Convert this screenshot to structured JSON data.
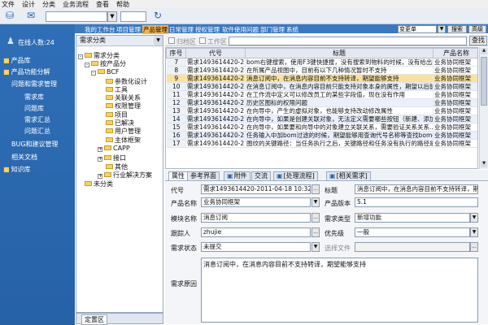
{
  "menu": {
    "items": [
      "文件",
      "设计",
      "分类",
      "业务流程",
      "查看",
      "帮助"
    ]
  },
  "toolbar": {
    "combo_value": "",
    "combo_arrow": "▼"
  },
  "leftnav": {
    "online": "在线人数:24",
    "items": [
      "产品库",
      "产品功能分解",
      "问题和需求管理",
      "需求库",
      "问题库",
      "需求汇总",
      "问题汇总",
      "BUG和建议管理",
      "相关文档",
      "知识库"
    ]
  },
  "topnav": {
    "items": [
      "我的工作台",
      "项目管理",
      "产品管理",
      "日常管理",
      "授权管理",
      "软件使用问题",
      "部门管理",
      "系统"
    ],
    "version_select": "变更单",
    "search_label": "搜索",
    "advanced_label": "高级"
  },
  "tree": {
    "title": "需求分类",
    "nodes": [
      "需求分类",
      "按产品分",
      "BCF",
      "参数化设计",
      "工具",
      "关联关系",
      "权限管理",
      "项目",
      "已解决",
      "用户管理",
      "主体框架",
      "CAPP",
      "接口",
      "其他",
      "行业解决方案",
      "未分类"
    ]
  },
  "bottom_tab": "定置区",
  "filter": {
    "check1": "归档区",
    "check2": "工作区",
    "find_label": "查找"
  },
  "grid": {
    "columns": [
      "序号",
      "代号",
      "标题",
      "产品名称"
    ],
    "rows": [
      {
        "n": "7",
        "code": "需求1493614420-2...",
        "title": "bom右键搜索，使用F3键快捷搜，没有搜索到物料的时候，没有给出提示...",
        "product": "业务协同框架"
      },
      {
        "n": "8",
        "code": "需求1493614420-2...",
        "title": "在所属产品视图中，目前有以下几种情况暂时不支持",
        "product": "业务协同框架"
      },
      {
        "n": "9",
        "code": "需求1493614420-2...",
        "title": "消息订阅中，在消息内容目前不支持转译，期望能够支持",
        "product": "业务协同框架"
      },
      {
        "n": "10",
        "code": "需求1493614420-2...",
        "title": "在消息订阅中，在消息内容目前只能支持对象本身的属性，期望以后能够支...",
        "product": "业务协同框架"
      },
      {
        "n": "11",
        "code": "需求1493614420-2...",
        "title": "在工作流中定义可以修改员工的某些字段值，现在没有作用",
        "product": "业务协同框架"
      },
      {
        "n": "12",
        "code": "需求1493614420-2...",
        "title": "历史区图标的权限问题",
        "product": "业务协同框架"
      },
      {
        "n": "13",
        "code": "需求1493614420-2...",
        "title": "在向导中，产生的虚拟对象，也能够支持改动修改属性",
        "product": "业务协同框架"
      },
      {
        "n": "14",
        "code": "需求1493614420-2...",
        "title": "在向导中，如果是创建关联对象，无法定义需要哪些按钮（新建、添加、...",
        "product": "业务协同框架"
      },
      {
        "n": "15",
        "code": "需求1493614420-2...",
        "title": "在向导中，如果要和向导中的对象建立关联关系，需要验证关系关系...",
        "product": "业务协同框架"
      },
      {
        "n": "16",
        "code": "需求1493614420-2...",
        "title": "任务输入中加bom过滤的时候，期望能够用查询代号名称等查找bomobj",
        "product": "业务协同框架"
      },
      {
        "n": "17",
        "code": "需求1493614420-2...",
        "title": "图纹的关键路径：当任务执行之后，关键路径和任务没有执行的路径是不...",
        "product": "业务协同框架"
      }
    ]
  },
  "tabs": [
    "属性",
    "参考界面",
    "附件",
    "交流",
    "[处理流程]",
    "[相关需求]"
  ],
  "form": {
    "code_label": "代号",
    "code_value": "需求1493614420-2011-04-18 10:32:42 ...",
    "title_label": "标题",
    "title_value": "消息订阅中，在消息内容目前不支持转译，期",
    "product_label": "产品名称",
    "product_value": "业务协同框架",
    "version_label": "产品版本",
    "version_value": "5.1",
    "module_label": "模块名称",
    "module_value": "消息订阅",
    "type_label": "需求类型",
    "type_value": "新增功能",
    "tracker_label": "跟踪人",
    "tracker_value": "zhujie",
    "priority_label": "优先级",
    "priority_value": "一般",
    "status_label": "需求状态",
    "status_value": "未提交",
    "file_label": "选择文件",
    "file_value": "",
    "reason_label": "需求原因",
    "reason_value": "消息订阅中，在消息内容目前不支持转译，期望能够支持"
  }
}
